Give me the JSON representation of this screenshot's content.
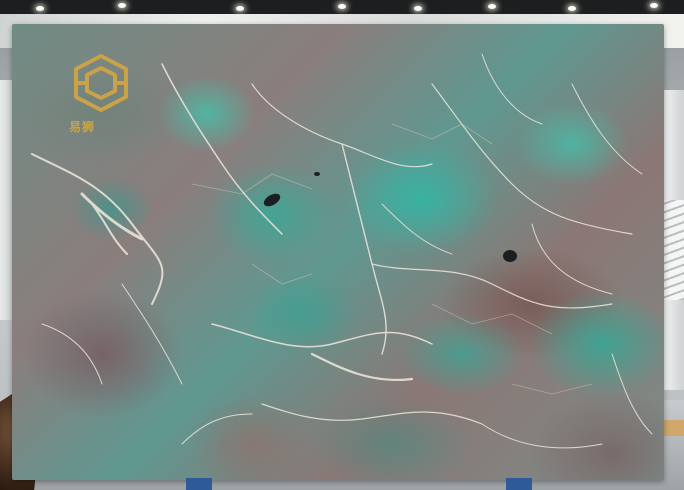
{
  "logo": {
    "text": "易狮",
    "color": "#caa24a",
    "icon": "hexagon-emblem-logo"
  },
  "scene": {
    "subject": "stone-slab",
    "accent_colors": [
      "#3fb7a4",
      "#8a7875",
      "#f1e8dd"
    ]
  }
}
